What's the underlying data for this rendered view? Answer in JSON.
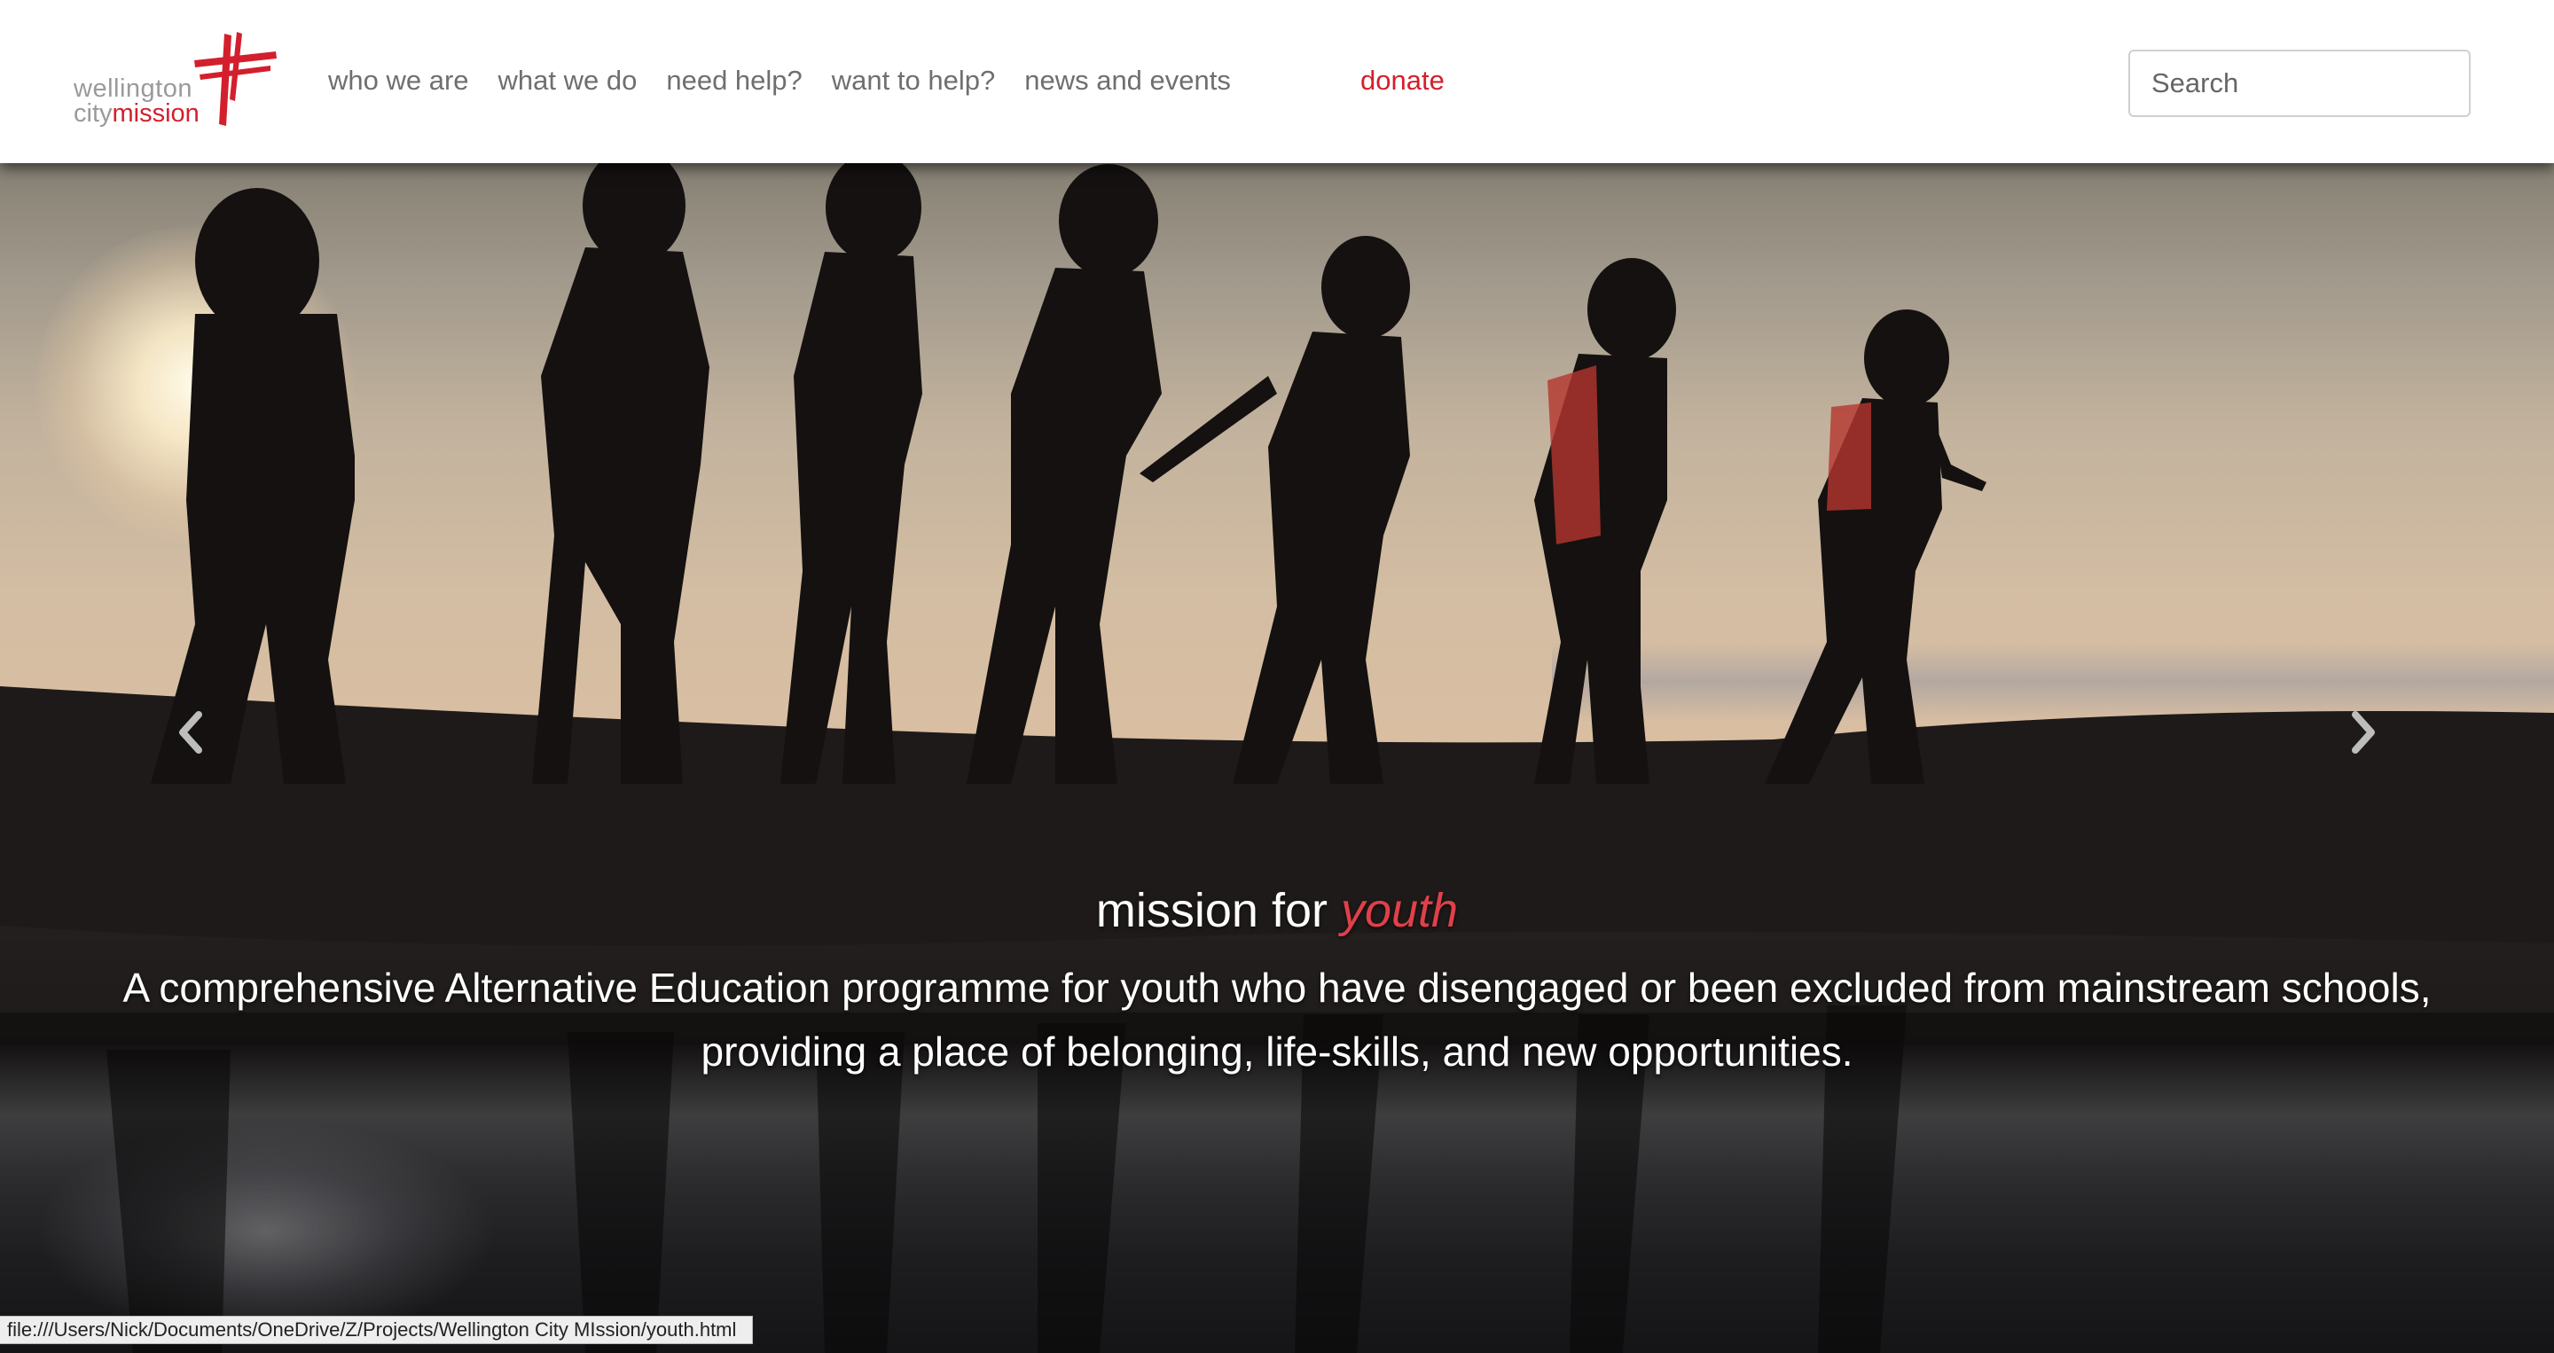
{
  "logo": {
    "line1": "wellington",
    "line2_city": "city",
    "line2_mission": "mission",
    "brand_red": "#d31f2d"
  },
  "nav": {
    "items": [
      {
        "label": "who we are"
      },
      {
        "label": "what we do"
      },
      {
        "label": "need help?"
      },
      {
        "label": "want to help?"
      },
      {
        "label": "news and events"
      }
    ],
    "donate": "donate"
  },
  "search": {
    "placeholder": "Search",
    "value": ""
  },
  "hero": {
    "image": "silhouetted-children-walking-on-rocks-at-sunset",
    "prev_icon": "chevron-left-icon",
    "next_icon": "chevron-right-icon",
    "caption_title_prefix": "mission for ",
    "caption_title_accent": "youth",
    "caption_text": "A comprehensive Alternative Education programme for youth who have disengaged or been excluded from mainstream schools, providing a place of belonging, life-skills, and new opportunities."
  },
  "status_bar": {
    "url": "file:///Users/Nick/Documents/OneDrive/Z/Projects/Wellington City MIssion/youth.html"
  }
}
